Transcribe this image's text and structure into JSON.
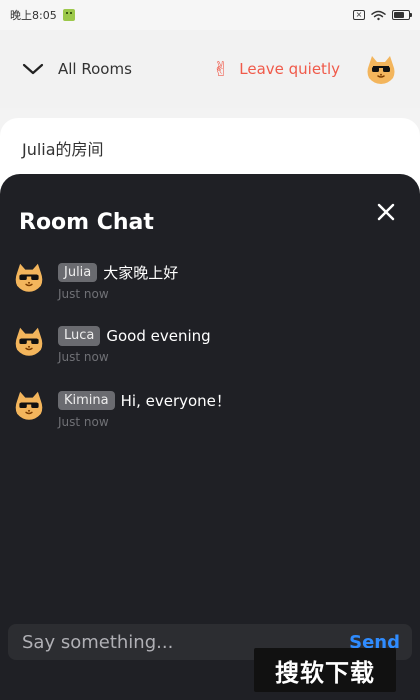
{
  "status_bar": {
    "time_text": "晚上8:05",
    "icons": [
      "sim-disabled-icon",
      "wifi-icon",
      "battery-icon",
      "status-emoji-icon"
    ]
  },
  "header": {
    "back_icon": "chevron-down-icon",
    "title": "All Rooms",
    "leave_icon": "peace-sign-icon",
    "leave_label": "Leave quietly",
    "avatar_icon": "cool-cat-avatar-icon"
  },
  "room": {
    "name": "Julia的房间"
  },
  "chat": {
    "title": "Room Chat",
    "close_icon": "close-icon",
    "messages": [
      {
        "user": "Julia",
        "text": "大家晚上好",
        "time": "Just now",
        "avatar_icon": "cool-cat-avatar-icon"
      },
      {
        "user": "Luca",
        "text": "Good evening",
        "time": "Just now",
        "avatar_icon": "cool-cat-avatar-icon"
      },
      {
        "user": "Kimina",
        "text": "Hi, everyone！",
        "time": "Just now",
        "avatar_icon": "cool-cat-avatar-icon"
      }
    ],
    "composer": {
      "placeholder": "Say something...",
      "send_label": "Send"
    }
  },
  "watermark": {
    "text": "搜软下载"
  },
  "colors": {
    "chat_bg": "#1f2025",
    "accent": "#2f8cff",
    "leave": "#f05a4a",
    "header_bg": "#f2f2f2"
  }
}
